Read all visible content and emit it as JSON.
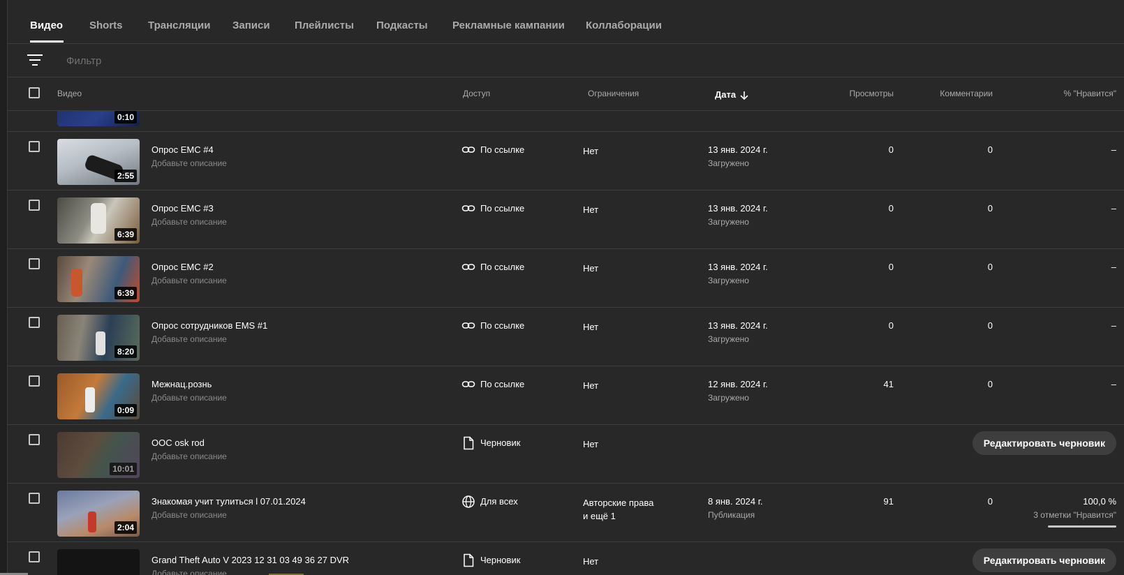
{
  "tabs": [
    {
      "label": "Видео",
      "active": true
    },
    {
      "label": "Shorts"
    },
    {
      "label": "Трансляции"
    },
    {
      "label": "Записи"
    },
    {
      "label": "Плейлисты"
    },
    {
      "label": "Подкасты"
    },
    {
      "label": "Рекламные кампании"
    },
    {
      "label": "Коллаборации"
    }
  ],
  "filter": {
    "placeholder": "Фильтр",
    "icon": "filter-icon"
  },
  "columns": {
    "video": "Видео",
    "access": "Доступ",
    "restrictions": "Ограничения",
    "date": "Дата",
    "views": "Просмотры",
    "comments": "Комментарии",
    "likes": "% \"Нравится\""
  },
  "partial_row": {
    "duration": "0:10"
  },
  "rows": [
    {
      "title": "Опрос ЕМС #4",
      "desc": "Добавьте описание",
      "duration": "2:55",
      "access": "По ссылке",
      "access_icon": "link-icon",
      "restrictions": "Нет",
      "date": "13 янв. 2024 г.",
      "status": "Загружено",
      "views": "0",
      "comments": "0",
      "likes": "–"
    },
    {
      "title": "Опрос ЕМС #3",
      "desc": "Добавьте описание",
      "duration": "6:39",
      "access": "По ссылке",
      "access_icon": "link-icon",
      "restrictions": "Нет",
      "date": "13 янв. 2024 г.",
      "status": "Загружено",
      "views": "0",
      "comments": "0",
      "likes": "–"
    },
    {
      "title": "Опрос ЕМС #2",
      "desc": "Добавьте описание",
      "duration": "6:39",
      "access": "По ссылке",
      "access_icon": "link-icon",
      "restrictions": "Нет",
      "date": "13 янв. 2024 г.",
      "status": "Загружено",
      "views": "0",
      "comments": "0",
      "likes": "–"
    },
    {
      "title": "Опрос сотрудников EMS #1",
      "desc": "Добавьте описание",
      "duration": "8:20",
      "access": "По ссылке",
      "access_icon": "link-icon",
      "restrictions": "Нет",
      "date": "13 янв. 2024 г.",
      "status": "Загружено",
      "views": "0",
      "comments": "0",
      "likes": "–"
    },
    {
      "title": "Межнац.рознь",
      "desc": "Добавьте описание",
      "duration": "0:09",
      "access": "По ссылке",
      "access_icon": "link-icon",
      "restrictions": "Нет",
      "date": "12 янв. 2024 г.",
      "status": "Загружено",
      "views": "41",
      "comments": "0",
      "likes": "–"
    },
    {
      "title": "OOC osk rod",
      "desc": "Добавьте описание",
      "duration": "10:01",
      "access": "Черновик",
      "access_icon": "draft-file-icon",
      "restrictions": "Нет",
      "draft_button": "Редактировать черновик"
    },
    {
      "title": "Знакомая учит тулиться l 07.01.2024",
      "desc": "Добавьте описание",
      "duration": "2:04",
      "access": "Для всех",
      "access_icon": "globe-icon",
      "restrictions_line1": "Авторские права",
      "restrictions_line2": "и ещё 1",
      "date": "8 янв. 2024 г.",
      "status": "Публикация",
      "views": "91",
      "comments": "0",
      "likes": "100,0 %",
      "likes_sub": "3 отметки \"Нравится\"",
      "like_ratio": 1.0
    },
    {
      "title": "Grand Theft Auto V 2023 12 31 03 49 36 27 DVR",
      "desc": "Добавьте описание",
      "access": "Черновик",
      "access_icon": "draft-file-icon",
      "restrictions": "Нет",
      "draft_button": "Редактировать черновик"
    }
  ]
}
